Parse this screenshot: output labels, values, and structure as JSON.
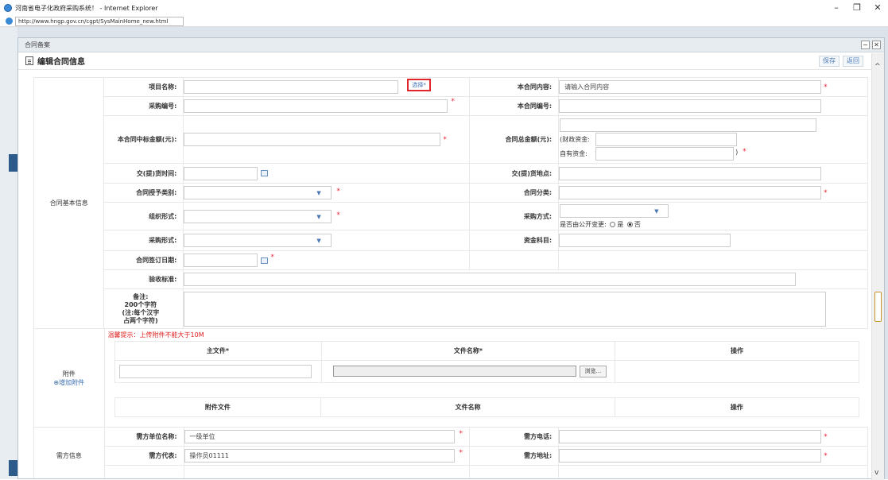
{
  "window": {
    "title": "河南省电子化政府采购系统！ - Internet Explorer",
    "address": "http://www.hngp.gov.cn/cgpt/SysMainHome_new.html",
    "min": "–",
    "restore": "❐",
    "close": "✕"
  },
  "dialog": {
    "tab_title": "合同备案",
    "heading": "编辑合同信息",
    "save": "保存",
    "back": "返回"
  },
  "basic": {
    "group": "合同基本信息",
    "project_name": "项目名称:",
    "choose": "选择*",
    "contract_content": "本合同内容:",
    "contract_content_placeholder": "请输入合同内容",
    "purchase_no": "采购编号:",
    "contract_no": "本合同编号:",
    "winning_amount": "本合同中标金额(元):",
    "total_amount": "合同总金额(元):",
    "fiscal_fund": "(财政资金:",
    "self_fund": "自有资金:",
    "close_paren": ")",
    "delivery_time": "交(提)货时间:",
    "delivery_place": "交(提)货地点:",
    "award_type": "合同授予类别:",
    "category": "合同分类:",
    "org_form": "组织形式:",
    "purchase_method": "采购方式:",
    "public_change": "是否由公开变更:",
    "yes": "是",
    "no": "否",
    "purchase_form": "采购形式:",
    "fund_subject": "资金科目:",
    "sign_date": "合同签订日期:",
    "acceptance": "验收标准:",
    "remark_1": "备注:",
    "remark_2": "200个字符",
    "remark_3": "(注:每个汉字",
    "remark_4": "占两个字符)"
  },
  "attach": {
    "warn": "温馨提示：上传附件不能大于10M",
    "group": "附件",
    "add": "增加附件",
    "main_file": "主文件*",
    "file_name": "文件名称*",
    "op": "操作",
    "browse": "浏览...",
    "att_file": "附件文件",
    "att_name": "文件名称",
    "att_op": "操作"
  },
  "buyer": {
    "group": "需方信息",
    "unit_name": "需方单位名称:",
    "unit_value": "一级单位",
    "phone": "需方电话:",
    "rep": "需方代表:",
    "rep_value": "操作员01111",
    "address": "需方地址:"
  }
}
